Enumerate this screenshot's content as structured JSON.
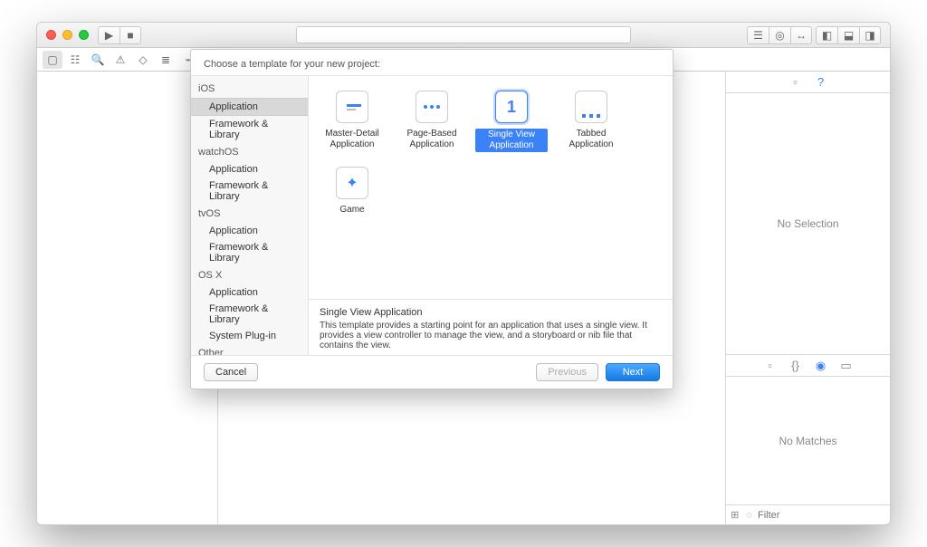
{
  "toolbar": {
    "run_icon": "▶",
    "stop_icon": "■"
  },
  "nav_icons": [
    "folder-icon",
    "hierarchy-icon",
    "search-icon",
    "warning-icon",
    "diamond-icon",
    "bars-icon",
    "breakpoint-icon",
    "log-icon"
  ],
  "right": {
    "no_selection": "No Selection",
    "no_matches": "No Matches",
    "filter_placeholder": "Filter"
  },
  "sheet": {
    "title": "Choose a template for your new project:",
    "platforms": [
      {
        "name": "iOS",
        "items": [
          "Application",
          "Framework & Library"
        ]
      },
      {
        "name": "watchOS",
        "items": [
          "Application",
          "Framework & Library"
        ]
      },
      {
        "name": "tvOS",
        "items": [
          "Application",
          "Framework & Library"
        ]
      },
      {
        "name": "OS X",
        "items": [
          "Application",
          "Framework & Library",
          "System Plug-in"
        ]
      },
      {
        "name": "Other",
        "items": []
      }
    ],
    "selected_sidebar_index": 0,
    "templates": [
      {
        "name": "Master-Detail Application",
        "icon": "master-detail"
      },
      {
        "name": "Page-Based Application",
        "icon": "page-based"
      },
      {
        "name": "Single View Application",
        "icon": "single-view",
        "selected": true
      },
      {
        "name": "Tabbed Application",
        "icon": "tabbed"
      },
      {
        "name": "Game",
        "icon": "game"
      }
    ],
    "detail": {
      "name": "Single View Application",
      "desc": "This template provides a starting point for an application that uses a single view. It provides a view controller to manage the view, and a storyboard or nib file that contains the view."
    },
    "buttons": {
      "cancel": "Cancel",
      "previous": "Previous",
      "next": "Next"
    }
  }
}
